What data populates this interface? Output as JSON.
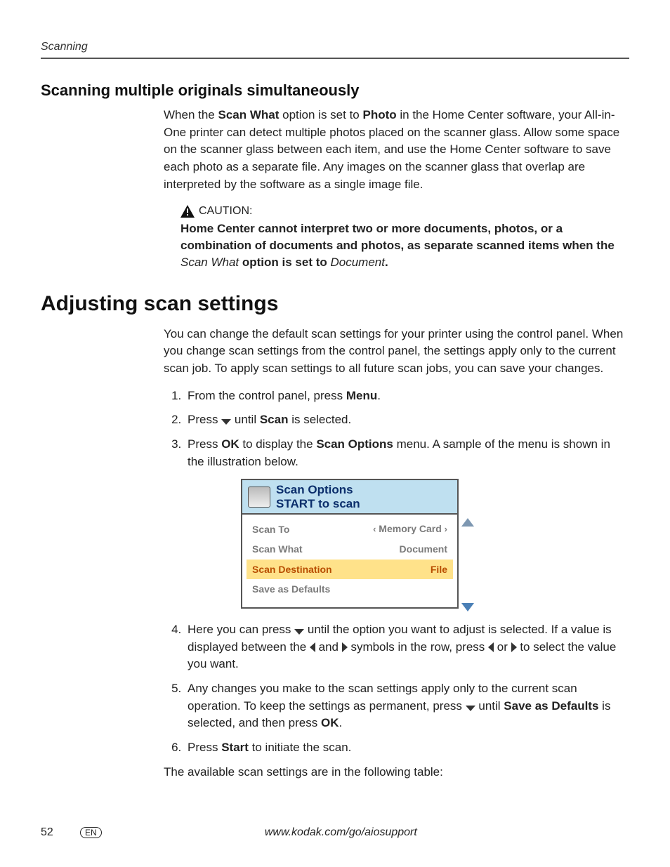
{
  "running_head": "Scanning",
  "section_h2": "Scanning multiple originals simultaneously",
  "p1": {
    "pre": "When the ",
    "b1": "Scan What",
    "mid1": " option is set to ",
    "b2": "Photo",
    "rest": " in the Home Center software, your All-in-One printer can detect multiple photos placed on the scanner glass. Allow some space on the scanner glass between each item, and use the Home Center software to save each photo as a separate file. Any images on the scanner glass that overlap are interpreted by the software as a single image file."
  },
  "caution": {
    "label": "CAUTION:",
    "b_line": "Home Center cannot interpret two or more documents, photos, or a combination of documents and photos, as separate scanned items when the ",
    "i1": "Scan What",
    "mid": " option is set to ",
    "i2": "Document",
    "tail": "."
  },
  "h1": "Adjusting scan settings",
  "p2": "You can change the default scan settings for your printer using the control panel. When you change scan settings from the control panel, the settings apply only to the current scan job. To apply scan settings to all future scan jobs, you can save your changes.",
  "steps": {
    "s1": {
      "pre": "From the control panel, press ",
      "b": "Menu",
      "post": "."
    },
    "s2": {
      "pre": "Press ",
      "mid": " until ",
      "b": "Scan",
      "post": " is selected."
    },
    "s3": {
      "pre": "Press ",
      "b1": "OK",
      "mid": " to display the ",
      "b2": "Scan Options",
      "post": " menu. A sample of the menu is shown in the illustration below."
    },
    "s4": {
      "pre": "Here you can press ",
      "mid1": " until the option you want to adjust is selected. If a value is displayed between the ",
      "mid2": " and ",
      "mid3": " symbols in the row, press ",
      "mid4": " or ",
      "post": " to select the value you want."
    },
    "s5": {
      "pre": "Any changes you make to the scan settings apply only to the current scan operation. To keep the settings as permanent, press ",
      "mid": " until ",
      "b1": "Save as Defaults",
      "mid2": " is selected, and then press ",
      "b2": "OK",
      "post": "."
    },
    "s6": {
      "pre": "Press ",
      "b": "Start",
      "post": " to initiate the scan."
    }
  },
  "p3": "The available scan settings are in the following table:",
  "lcd": {
    "title1": "Scan Options",
    "title2": "START to scan",
    "rows": [
      {
        "l": "Scan To",
        "r": "Memory Card",
        "chev": true
      },
      {
        "l": "Scan What",
        "r": "Document"
      },
      {
        "l": "Scan Destination",
        "r": "File",
        "sel": true
      },
      {
        "l": "Save as Defaults",
        "r": ""
      }
    ]
  },
  "footer": {
    "page": "52",
    "lang": "EN",
    "url": "www.kodak.com/go/aiosupport"
  }
}
